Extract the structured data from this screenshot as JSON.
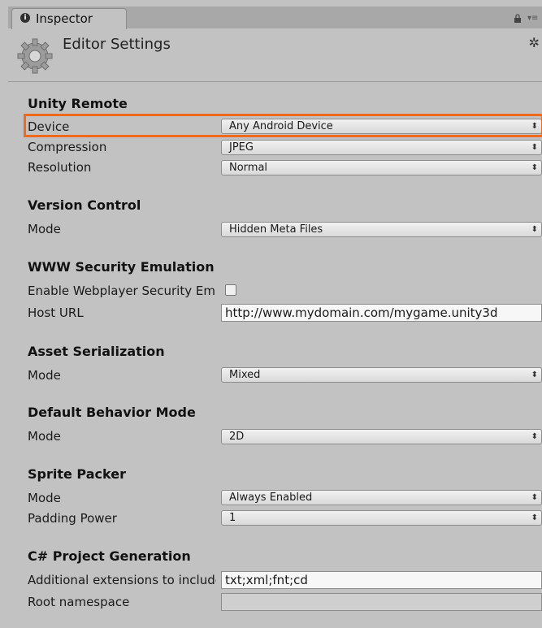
{
  "tab": {
    "label": "Inspector"
  },
  "header": {
    "title": "Editor Settings"
  },
  "sections": {
    "unity_remote": {
      "title": "Unity Remote",
      "device": {
        "label": "Device",
        "value": "Any Android Device"
      },
      "compression": {
        "label": "Compression",
        "value": "JPEG"
      },
      "resolution": {
        "label": "Resolution",
        "value": "Normal"
      }
    },
    "version_control": {
      "title": "Version Control",
      "mode": {
        "label": "Mode",
        "value": "Hidden Meta Files"
      }
    },
    "www_security": {
      "title": "WWW Security Emulation",
      "enable": {
        "label": "Enable Webplayer Security Emulation",
        "checked": false
      },
      "host_url": {
        "label": "Host URL",
        "value": "http://www.mydomain.com/mygame.unity3d"
      }
    },
    "asset_serialization": {
      "title": "Asset Serialization",
      "mode": {
        "label": "Mode",
        "value": "Mixed"
      }
    },
    "default_behavior": {
      "title": "Default Behavior Mode",
      "mode": {
        "label": "Mode",
        "value": "2D"
      }
    },
    "sprite_packer": {
      "title": "Sprite Packer",
      "mode": {
        "label": "Mode",
        "value": "Always Enabled"
      },
      "padding": {
        "label": "Padding Power",
        "value": "1"
      }
    },
    "csharp": {
      "title": "C# Project Generation",
      "extensions": {
        "label": "Additional extensions to include",
        "value": "txt;xml;fnt;cd"
      },
      "namespace": {
        "label": "Root namespace",
        "value": ""
      }
    }
  },
  "colors": {
    "highlight": "#f06a1e",
    "panel": "#c2c2c2"
  }
}
